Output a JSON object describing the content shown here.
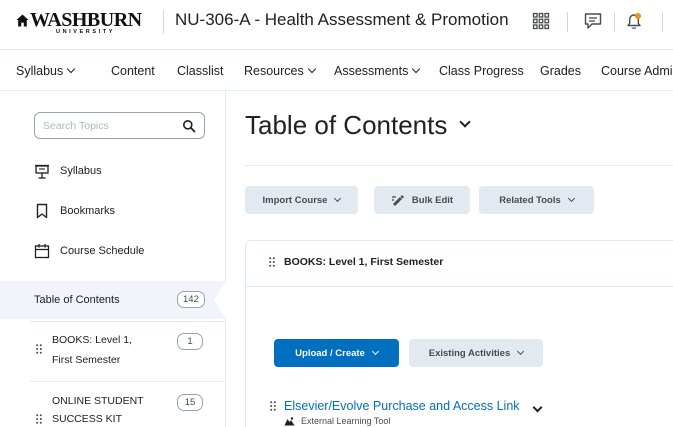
{
  "header": {
    "logo_word": "WASHBURN",
    "logo_sub": "UNIVERSITY",
    "course_title": "NU-306-A - Health Assessment & Promotion",
    "icons": [
      "apps-grid-icon",
      "message-alerts-icon",
      "notifications-bell-icon"
    ]
  },
  "nav": {
    "items": [
      {
        "label": "Syllabus",
        "dropdown": true
      },
      {
        "label": "Content",
        "dropdown": false
      },
      {
        "label": "Classlist",
        "dropdown": false
      },
      {
        "label": "Resources",
        "dropdown": true
      },
      {
        "label": "Assessments",
        "dropdown": true
      },
      {
        "label": "Class Progress",
        "dropdown": false
      },
      {
        "label": "Grades",
        "dropdown": false
      },
      {
        "label": "Course Admi",
        "dropdown": false
      }
    ]
  },
  "sidebar": {
    "search_placeholder": "Search Topics",
    "links": [
      {
        "label": "Syllabus",
        "icon": "syllabus-icon"
      },
      {
        "label": "Bookmarks",
        "icon": "bookmark-icon"
      },
      {
        "label": "Course Schedule",
        "icon": "calendar-icon"
      }
    ],
    "toc": {
      "label": "Table of Contents",
      "count": "142"
    },
    "modules": [
      {
        "line1": "BOOKS: Level 1,",
        "line2": "First Semester",
        "count": "1"
      },
      {
        "line1": "ONLINE STUDENT",
        "line2": "SUCCESS KIT",
        "count": "15"
      }
    ]
  },
  "main": {
    "title": "Table of Contents",
    "toolbar": {
      "import_label": "Import Course",
      "bulk_edit_label": "Bulk Edit",
      "related_tools_label": "Related Tools"
    },
    "module": {
      "title": "BOOKS: Level 1, First Semester",
      "upload_label": "Upload / Create",
      "existing_label": "Existing Activities",
      "item": {
        "title": "Elsevier/Evolve Purchase and Access Link",
        "type": "External Learning Tool"
      }
    }
  },
  "colors": {
    "primary": "#006fbf",
    "link": "#006fbf",
    "button_bg": "#e3e9f1",
    "notification": "#f28e1c",
    "toc_highlight": "#f1f5fb"
  }
}
